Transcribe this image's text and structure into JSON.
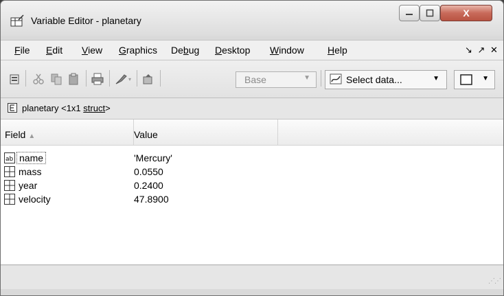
{
  "window": {
    "title": "Variable Editor - planetary",
    "close_label": "X"
  },
  "menu": [
    {
      "label": "File",
      "key": "F",
      "rest": "ile"
    },
    {
      "label": "Edit",
      "key": "E",
      "rest": "dit"
    },
    {
      "label": "View",
      "key": "V",
      "rest": "iew"
    },
    {
      "label": "Graphics",
      "key": "G",
      "rest": "raphics"
    },
    {
      "label": "Debug",
      "pre": "De",
      "key": "b",
      "rest": "ug"
    },
    {
      "label": "Desktop",
      "key": "D",
      "rest": "esktop"
    },
    {
      "label": "Window",
      "key": "W",
      "rest": "indow"
    },
    {
      "label": "Help",
      "key": "H",
      "rest": "elp"
    }
  ],
  "menu_tools": "↘ ↗ ✕",
  "toolbar": {
    "base_combo": "Base",
    "select_data": "Select data...",
    "icons": [
      "new-variable-icon",
      "cut-icon",
      "copy-icon",
      "paste-icon",
      "print-icon",
      "brush-icon",
      "parent-folder-icon",
      "plot-data-icon",
      "plot-selector-icon"
    ]
  },
  "path": {
    "name": "planetary",
    "size": "<1x1",
    "type": "struct",
    "suffix": ">"
  },
  "table": {
    "headers": {
      "field": "Field",
      "value": "Value"
    },
    "rows": [
      {
        "field": "name",
        "value": "'Mercury'",
        "icon": "char-array-icon"
      },
      {
        "field": "mass",
        "value": "0.0550",
        "icon": "numeric-array-icon"
      },
      {
        "field": "year",
        "value": "0.2400",
        "icon": "numeric-array-icon"
      },
      {
        "field": "velocity",
        "value": "47.8900",
        "icon": "numeric-array-icon"
      }
    ]
  }
}
